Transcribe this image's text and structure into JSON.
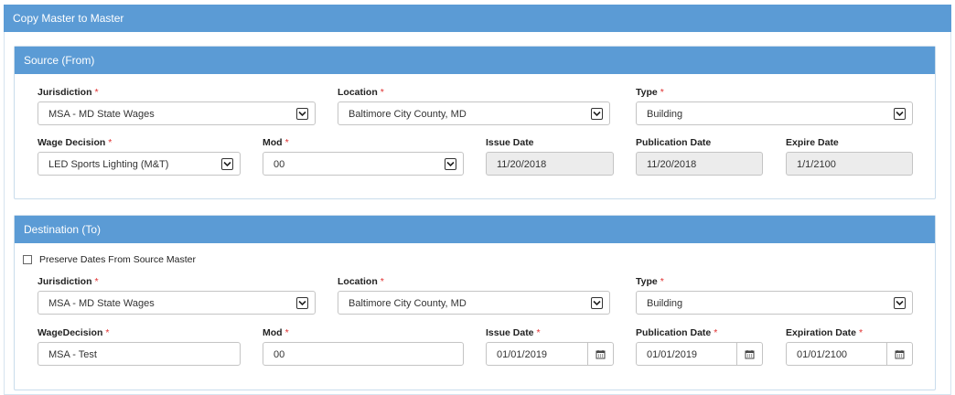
{
  "window": {
    "title": "Copy Master to Master"
  },
  "source": {
    "title": "Source (From)",
    "jurisdiction": {
      "label": "Jurisdiction",
      "value": "MSA - MD State Wages"
    },
    "location": {
      "label": "Location",
      "value": "Baltimore City County, MD"
    },
    "type": {
      "label": "Type",
      "value": "Building"
    },
    "wage_decision": {
      "label": "Wage Decision",
      "value": "LED Sports Lighting (M&T)"
    },
    "mod": {
      "label": "Mod",
      "value": "00"
    },
    "issue_date": {
      "label": "Issue Date",
      "value": "11/20/2018"
    },
    "publication_date": {
      "label": "Publication Date",
      "value": "11/20/2018"
    },
    "expire_date": {
      "label": "Expire Date",
      "value": "1/1/2100"
    }
  },
  "destination": {
    "title": "Destination (To)",
    "preserve_dates": {
      "label": "Preserve Dates From Source Master",
      "checked": false
    },
    "jurisdiction": {
      "label": "Jurisdiction",
      "value": "MSA - MD State Wages"
    },
    "location": {
      "label": "Location",
      "value": "Baltimore City County, MD"
    },
    "type": {
      "label": "Type",
      "value": "Building"
    },
    "wage_decision": {
      "label": "WageDecision",
      "value": "MSA - Test"
    },
    "mod": {
      "label": "Mod",
      "value": "00"
    },
    "issue_date": {
      "label": "Issue Date",
      "value": "01/01/2019"
    },
    "publication_date": {
      "label": "Publication Date",
      "value": "01/01/2019"
    },
    "expiration_date": {
      "label": "Expiration Date",
      "value": "01/01/2100"
    }
  },
  "required_marker": "*",
  "icons": {
    "select": "chevron-down-icon",
    "date": "calendar-icon"
  },
  "colors": {
    "header": "#5b9bd5",
    "required": "#e03030",
    "readonly_bg": "#ececec"
  }
}
